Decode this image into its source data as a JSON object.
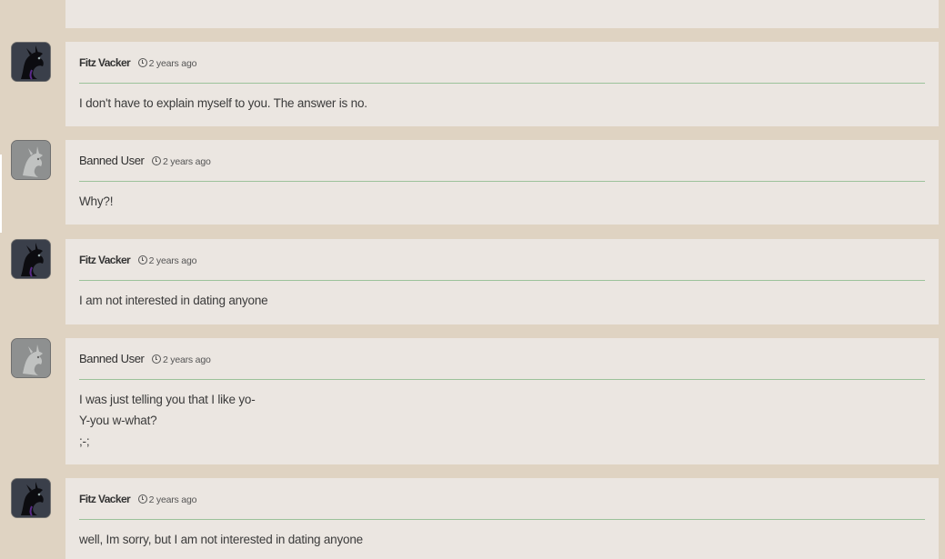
{
  "comments": [
    {
      "author": "Fitz Vacker",
      "avatar_icon": "black-dragon-avatar-icon",
      "time": "2 years ago",
      "lines": [
        "I don't have to explain myself to you. The answer is no."
      ]
    },
    {
      "author": "Banned User",
      "avatar_icon": "grey-dragon-avatar-icon",
      "time": "2 years ago",
      "lines": [
        "Why?!"
      ]
    },
    {
      "author": "Fitz Vacker",
      "avatar_icon": "black-dragon-avatar-icon",
      "time": "2 years ago",
      "lines": [
        "I am not interested in dating anyone"
      ]
    },
    {
      "author": "Banned User",
      "avatar_icon": "grey-dragon-avatar-icon",
      "time": "2 years ago",
      "lines": [
        "I was just telling you that I like yo-",
        "Y-you w-what?",
        ";-;"
      ]
    },
    {
      "author": "Fitz Vacker",
      "avatar_icon": "black-dragon-avatar-icon",
      "time": "2 years ago",
      "lines": [
        "well, Im sorry, but I am not interested in dating anyone"
      ]
    }
  ],
  "colors": {
    "page_background": "#dfd3c2",
    "card_background": "#ebe6e1",
    "divider": "#9cc29a"
  }
}
